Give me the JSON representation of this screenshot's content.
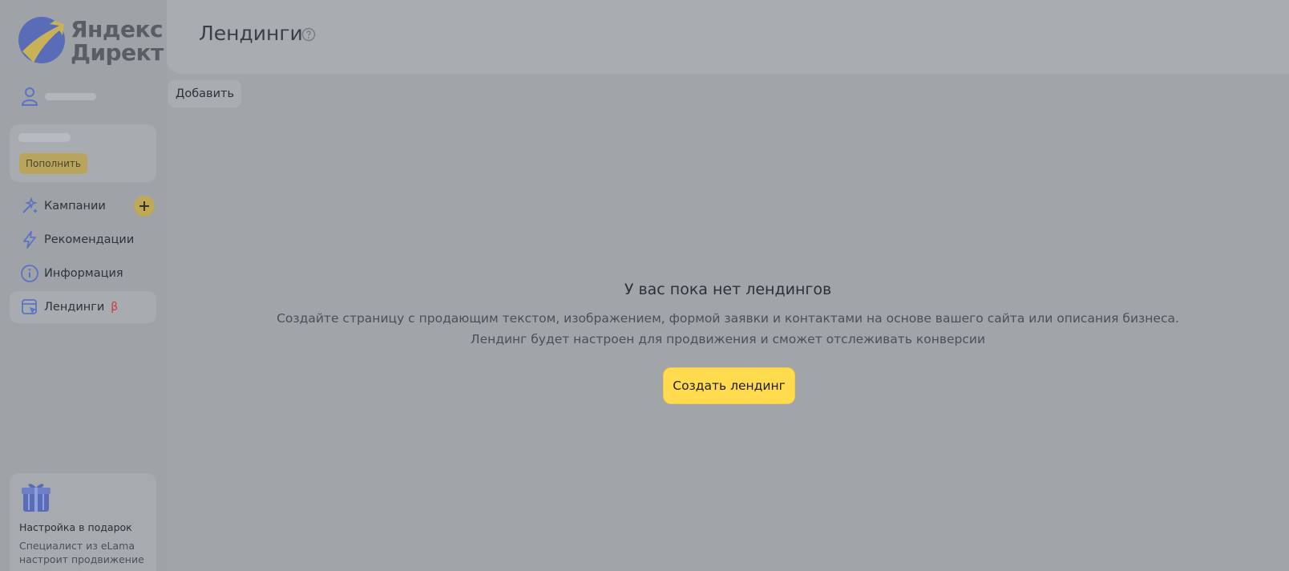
{
  "brand": {
    "line1": "Яндекс",
    "line2": "Директ"
  },
  "sidebar": {
    "topup_label": "Пополнить",
    "nav": [
      {
        "label": "Кампании",
        "icon": "magic-wand-icon"
      },
      {
        "label": "Рекомендации",
        "icon": "lightning-icon"
      },
      {
        "label": "Информация",
        "icon": "info-icon"
      },
      {
        "label": "Лендинги",
        "icon": "landing-page-icon",
        "badge": "β"
      }
    ],
    "promo": {
      "title": "Настройка в подарок",
      "desc": "Специалист из eLama настроит продвижение"
    }
  },
  "header": {
    "title": "Лендинги"
  },
  "toolbar": {
    "add_label": "Добавить"
  },
  "empty": {
    "title": "У вас пока нет лендингов",
    "line1": "Создайте страницу с продающим текстом, изображением, формой заявки и контактами на основе вашего сайта или описания бизнеса.",
    "line2": "Лендинг будет настроен для продвижения и сможет отслеживать конверсии",
    "cta": "Создать лендинг"
  },
  "colors": {
    "accent": "#ffdb4d",
    "overlay": "#a1a5a9",
    "beta": "#c83b3b"
  }
}
